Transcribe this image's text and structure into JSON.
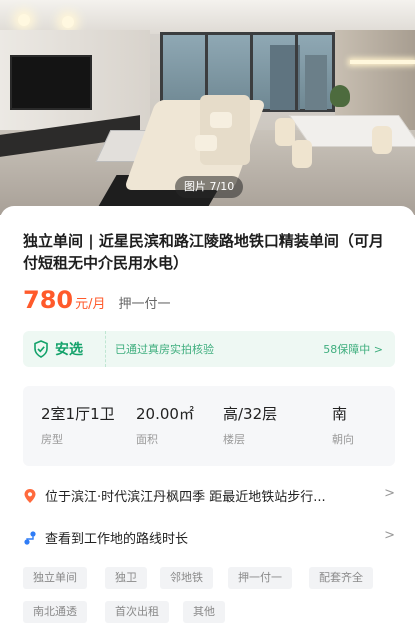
{
  "photo": {
    "counter": "图片 7/10"
  },
  "listing": {
    "title": "独立单间 | 近星民滨和路江陵路地铁口精装单间（可月付短租无中介民用水电）",
    "price": "780",
    "price_unit": "元/月",
    "payment": "押一付一"
  },
  "anxuan": {
    "brand": "安选",
    "description": "已通过真房实拍核验",
    "guarantee": "58保障中 >",
    "accent_color": "#13a26a"
  },
  "info": [
    {
      "value": "2室1厅1卫",
      "label": "房型"
    },
    {
      "value": "20.00㎡",
      "label": "面积"
    },
    {
      "value": "高/32层",
      "label": "楼层"
    },
    {
      "value": "南",
      "label": "朝向"
    }
  ],
  "location": {
    "text": "位于滨江·时代滨江丹枫四季 距最近地铁站步行...",
    "icon": "location-pin-icon"
  },
  "commute": {
    "text": "查看到工作地的路线时长",
    "icon": "route-icon"
  },
  "tags": [
    "独立单间",
    "独卫",
    "邻地铁",
    "押一付一",
    "配套齐全",
    "南北通透",
    "首次出租",
    "其他"
  ],
  "colors": {
    "price": "#ff5a2b",
    "tag_bg": "#f2f3f5"
  }
}
